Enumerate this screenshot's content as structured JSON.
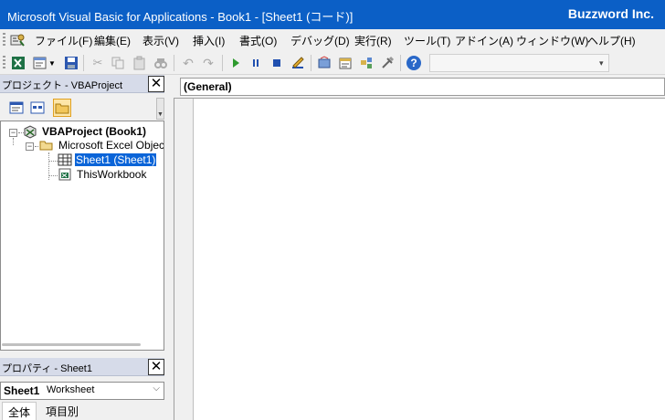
{
  "window": {
    "title": "Microsoft Visual Basic for Applications - Book1 - [Sheet1 (コード)]",
    "brand": "Buzzword Inc."
  },
  "menu": [
    {
      "label": "ファイル(F)"
    },
    {
      "label": "編集(E)"
    },
    {
      "label": "表示(V)"
    },
    {
      "label": "挿入(I)"
    },
    {
      "label": "書式(O)"
    },
    {
      "label": "デバッグ(D)"
    },
    {
      "label": "実行(R)"
    },
    {
      "label": "ツール(T)"
    },
    {
      "label": "アドイン(A)"
    },
    {
      "label": "ウィンドウ(W)"
    },
    {
      "label": "ヘルプ(H)"
    }
  ],
  "toolbar": {
    "icons": [
      "excel-view-icon",
      "insert-module-icon",
      "save-icon",
      "cut-icon",
      "copy-icon",
      "paste-icon",
      "find-icon",
      "undo-icon",
      "redo-icon",
      "run-icon",
      "break-icon",
      "reset-icon",
      "design-mode-icon",
      "project-explorer-icon",
      "properties-icon",
      "object-browser-icon",
      "toolbox-icon",
      "help-icon"
    ],
    "colors": {
      "run": "#2e9a2e",
      "pause": "#2050b0",
      "stop": "#2050b0",
      "help": "#2a68c8"
    }
  },
  "project_pane": {
    "title": "プロジェクト - VBAProject",
    "tree": {
      "root": "VBAProject (Book1)",
      "folder": "Microsoft Excel Objects",
      "items": [
        "Sheet1 (Sheet1)",
        "ThisWorkbook"
      ],
      "selected": "Sheet1 (Sheet1)"
    }
  },
  "properties_pane": {
    "title": "プロパティ - Sheet1",
    "object_name": "Sheet1",
    "object_type": "Worksheet",
    "tabs": [
      "全体",
      "項目別"
    ],
    "active_tab": "全体"
  },
  "code_window": {
    "object_combo": "(General)"
  },
  "colors": {
    "titlebar": "#0b5fc6",
    "pane_header": "#d6dbe9",
    "selection": "#0a64d8"
  }
}
